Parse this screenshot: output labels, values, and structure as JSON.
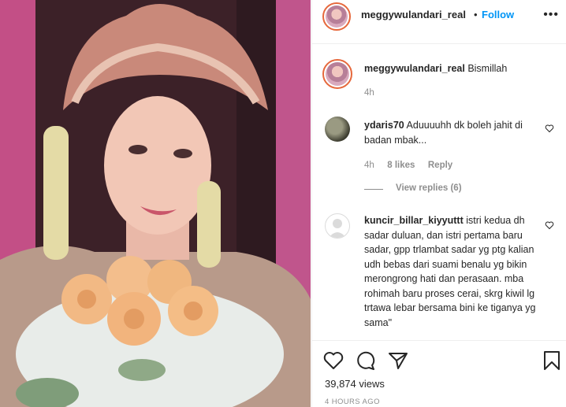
{
  "post": {
    "username": "meggywulandari_real",
    "follow_label": "Follow",
    "more_label": "•••",
    "caption": "Bismillah",
    "caption_time": "4h"
  },
  "comments": [
    {
      "username": "ydaris70",
      "text": "Aduuuuhh dk boleh jahit di badan mbak...",
      "time": "4h",
      "likes": "8 likes",
      "reply_label": "Reply",
      "view_replies": "View replies (6)"
    },
    {
      "username": "kuncir_billar_kiyyuttt",
      "text": "istri kedua dh sadar duluan, dan istri pertama baru sadar, gpp trlambat sadar yg ptg kalian udh bebas dari suami benalu yg bikin merongrong hati dan perasaan. mba rohimah baru proses cerai, skrg kiwil lg trtawa lebar bersama bini ke tiganya yg sama\""
    }
  ],
  "footer": {
    "views": "39,874 views",
    "timestamp": "4 HOURS AGO"
  },
  "icons": [
    "more-icon",
    "heart-icon",
    "comment-icon",
    "share-icon",
    "save-icon"
  ]
}
